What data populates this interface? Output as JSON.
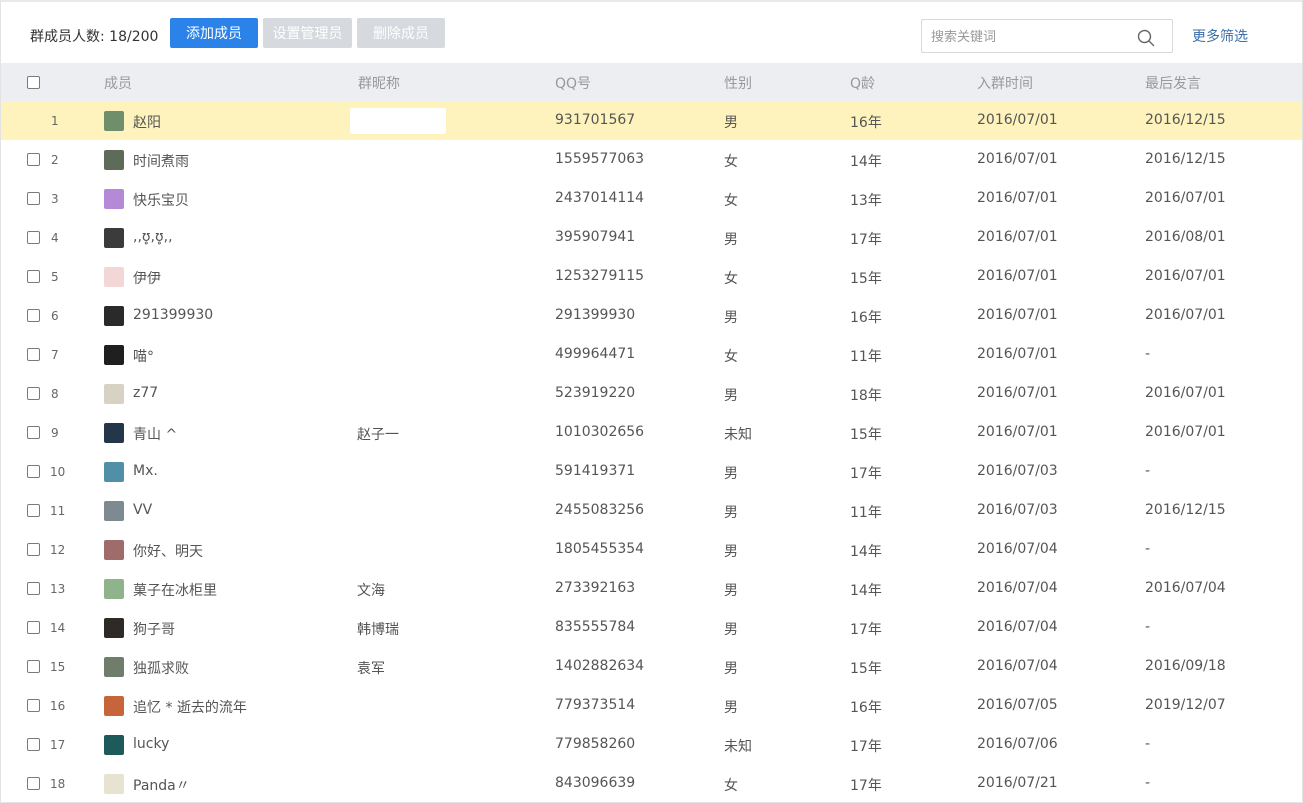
{
  "toolbar": {
    "count_label": "群成员人数: 18/200",
    "add_label": "添加成员",
    "admin_label": "设置管理员",
    "remove_label": "删除成员",
    "search_placeholder": "搜索关键词",
    "more_filter_label": "更多筛选"
  },
  "table": {
    "columns": [
      "成员",
      "群昵称",
      "QQ号",
      "性别",
      "Q龄",
      "入群时间",
      "最后发言"
    ],
    "rows": [
      {
        "index": "1",
        "member": "赵阳",
        "nickname": "",
        "qq": "931701567",
        "gender": "男",
        "q_age": "16年",
        "join": "2016/07/01",
        "last": "2016/12/15",
        "avatar_color": "#6f8f6a",
        "highlight": true
      },
      {
        "index": "2",
        "member": "时间煮雨",
        "nickname": "",
        "qq": "1559577063",
        "gender": "女",
        "q_age": "14年",
        "join": "2016/07/01",
        "last": "2016/12/15",
        "avatar_color": "#5d6b58"
      },
      {
        "index": "3",
        "member": "快乐宝贝",
        "nickname": "",
        "qq": "2437014114",
        "gender": "女",
        "q_age": "13年",
        "join": "2016/07/01",
        "last": "2016/07/01",
        "avatar_color": "#b48ad6"
      },
      {
        "index": "4",
        "member": ",,ʊ̥,ʊ̥,,",
        "nickname": "",
        "qq": "395907941",
        "gender": "男",
        "q_age": "17年",
        "join": "2016/07/01",
        "last": "2016/08/01",
        "avatar_color": "#3b3b3b"
      },
      {
        "index": "5",
        "member": "伊伊",
        "nickname": "",
        "qq": "1253279115",
        "gender": "女",
        "q_age": "15年",
        "join": "2016/07/01",
        "last": "2016/07/01",
        "avatar_color": "#f3d6d6"
      },
      {
        "index": "6",
        "member": "291399930",
        "nickname": "",
        "qq": "291399930",
        "gender": "男",
        "q_age": "16年",
        "join": "2016/07/01",
        "last": "2016/07/01",
        "avatar_color": "#2a2a2a"
      },
      {
        "index": "7",
        "member": "喵°",
        "nickname": "",
        "qq": "499964471",
        "gender": "女",
        "q_age": "11年",
        "join": "2016/07/01",
        "last": "-",
        "avatar_color": "#1f1f1f"
      },
      {
        "index": "8",
        "member": "z77",
        "nickname": "",
        "qq": "523919220",
        "gender": "男",
        "q_age": "18年",
        "join": "2016/07/01",
        "last": "2016/07/01",
        "avatar_color": "#d8d2c4"
      },
      {
        "index": "9",
        "member": "青山 ^",
        "nickname": "赵子一",
        "qq": "1010302656",
        "gender": "未知",
        "q_age": "15年",
        "join": "2016/07/01",
        "last": "2016/07/01",
        "avatar_color": "#23364a"
      },
      {
        "index": "10",
        "member": "Mx.",
        "nickname": "",
        "qq": "591419371",
        "gender": "男",
        "q_age": "17年",
        "join": "2016/07/03",
        "last": "-",
        "avatar_color": "#4f8fa8"
      },
      {
        "index": "11",
        "member": "VV",
        "nickname": "",
        "qq": "2455083256",
        "gender": "男",
        "q_age": "11年",
        "join": "2016/07/03",
        "last": "2016/12/15",
        "avatar_color": "#7d8a8f"
      },
      {
        "index": "12",
        "member": "你好、明天",
        "nickname": "",
        "qq": "1805455354",
        "gender": "男",
        "q_age": "14年",
        "join": "2016/07/04",
        "last": "-",
        "avatar_color": "#a06b6b"
      },
      {
        "index": "13",
        "member": "菓子在冰柜里",
        "nickname": "文海",
        "qq": "273392163",
        "gender": "男",
        "q_age": "14年",
        "join": "2016/07/04",
        "last": "2016/07/04",
        "avatar_color": "#8fb38a"
      },
      {
        "index": "14",
        "member": "狗子哥",
        "nickname": "韩博瑞",
        "qq": "835555784",
        "gender": "男",
        "q_age": "17年",
        "join": "2016/07/04",
        "last": "-",
        "avatar_color": "#2e2a26"
      },
      {
        "index": "15",
        "member": "独孤求败",
        "nickname": "袁军",
        "qq": "1402882634",
        "gender": "男",
        "q_age": "15年",
        "join": "2016/07/04",
        "last": "2016/09/18",
        "avatar_color": "#6f7d6a"
      },
      {
        "index": "16",
        "member": "追忆 * 逝去的流年",
        "nickname": "",
        "qq": "779373514",
        "gender": "男",
        "q_age": "16年",
        "join": "2016/07/05",
        "last": "2019/12/07",
        "avatar_color": "#c7653a"
      },
      {
        "index": "17",
        "member": "lucky",
        "nickname": "",
        "qq": "779858260",
        "gender": "未知",
        "q_age": "17年",
        "join": "2016/07/06",
        "last": "-",
        "avatar_color": "#1f5a5a"
      },
      {
        "index": "18",
        "member": "Panda〃",
        "nickname": "",
        "qq": "843096639",
        "gender": "女",
        "q_age": "17年",
        "join": "2016/07/21",
        "last": "-",
        "avatar_color": "#e8e2d0"
      }
    ]
  },
  "colors": {
    "primary": "#2b83ea",
    "highlight_row": "#fef3bc",
    "header_bg": "#eceef2",
    "link": "#3a6ea8"
  }
}
